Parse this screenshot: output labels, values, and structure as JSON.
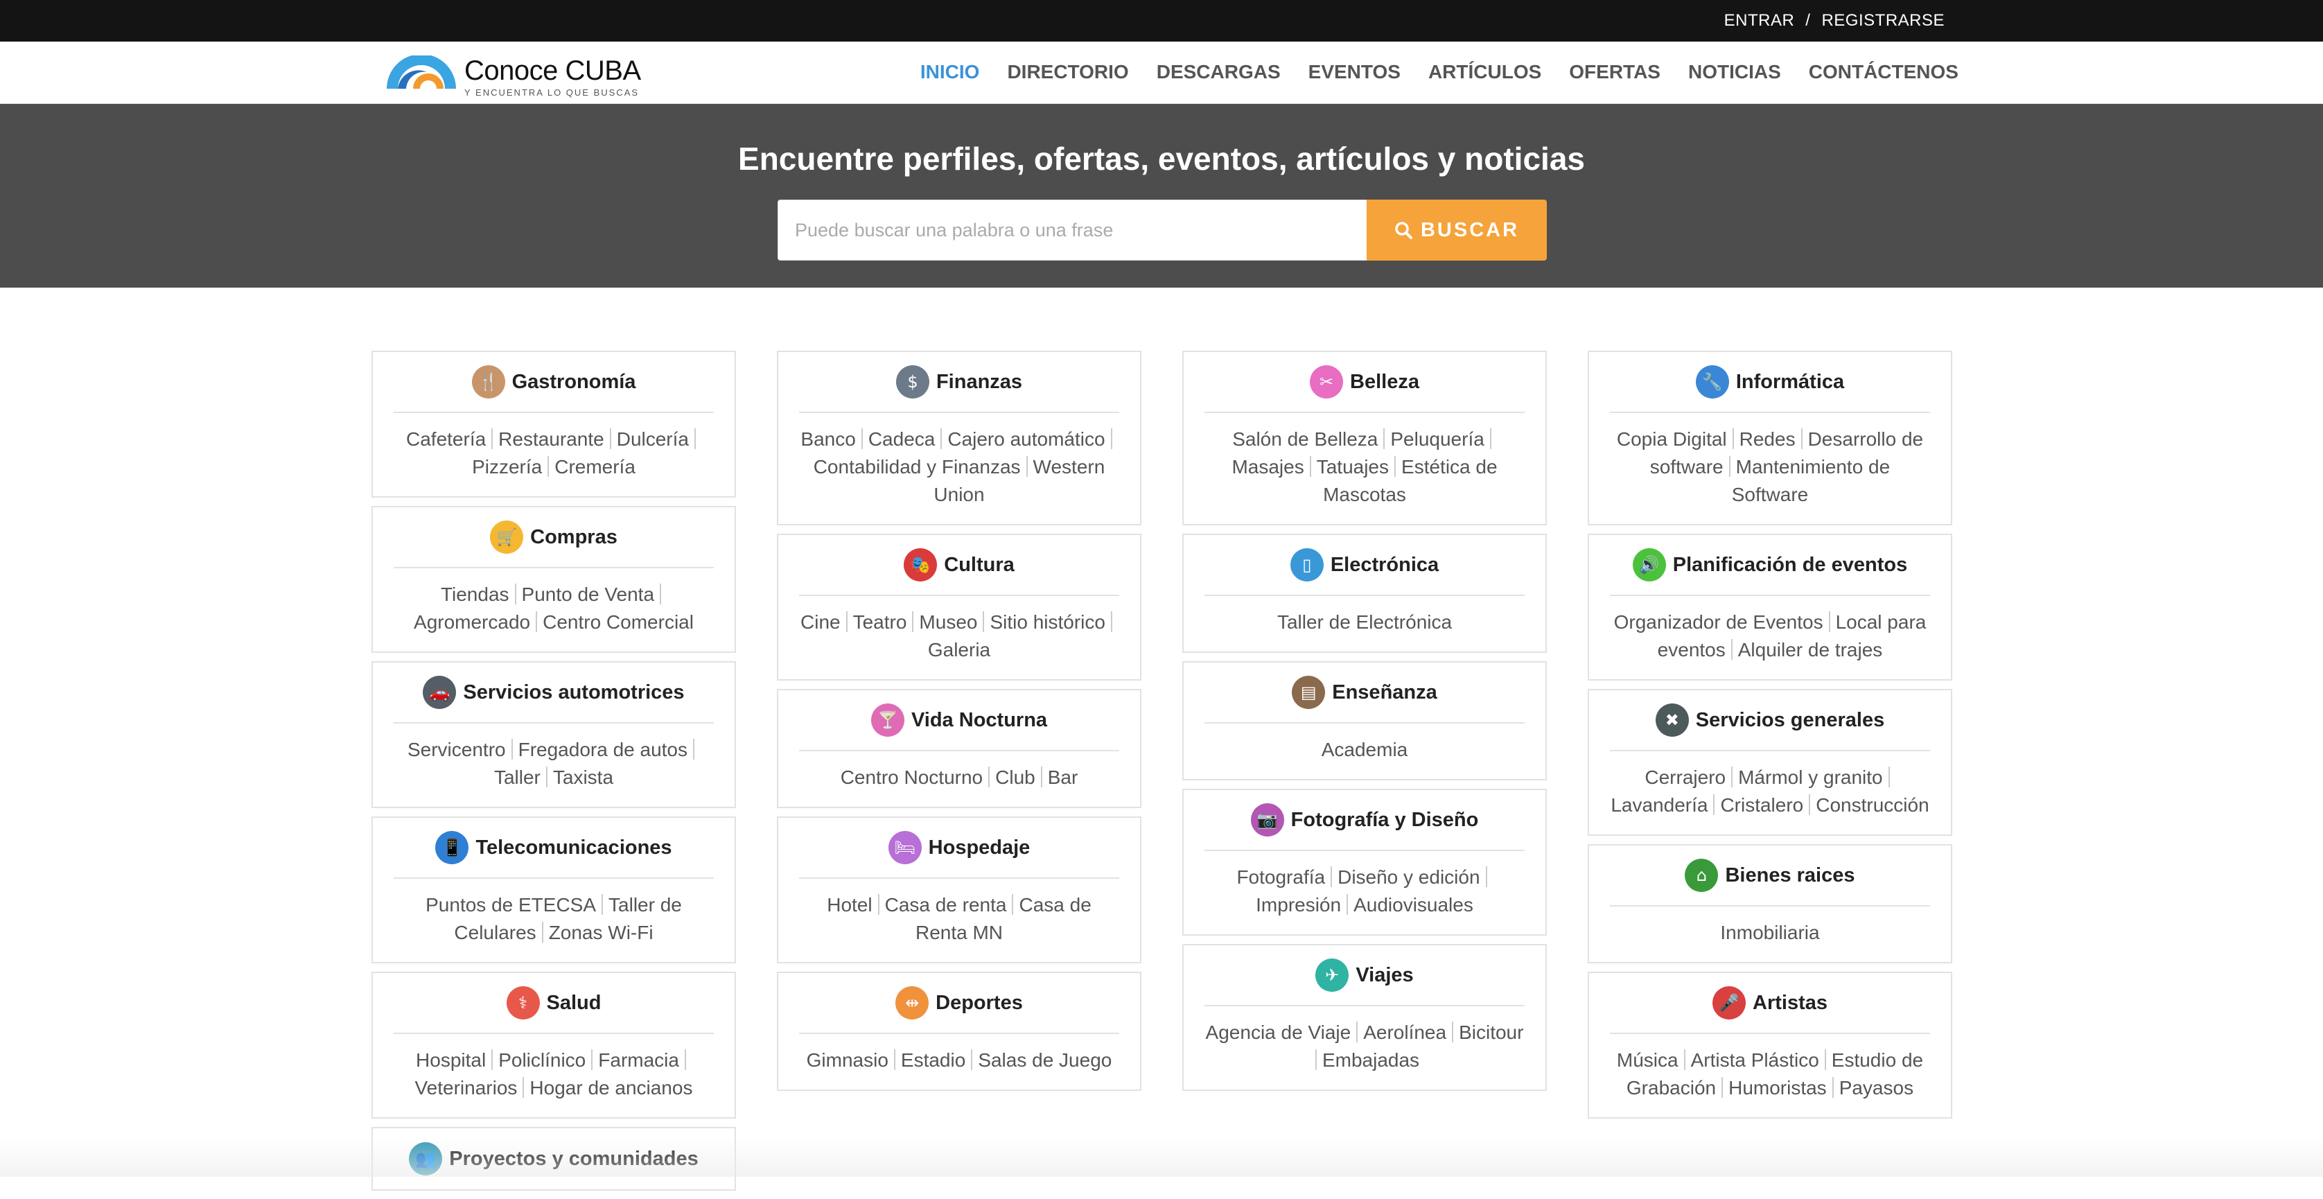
{
  "topbar": {
    "login": "ENTRAR",
    "separator": "/",
    "register": "REGISTRARSE"
  },
  "brand": {
    "name": "Conoce CUBA",
    "tagline": "Y ENCUENTRA LO QUE BUSCAS"
  },
  "nav": [
    "INICIO",
    "DIRECTORIO",
    "DESCARGAS",
    "EVENTOS",
    "ARTÍCULOS",
    "OFERTAS",
    "NOTICIAS",
    "CONTÁCTENOS"
  ],
  "hero": {
    "title": "Encuentre perfiles, ofertas, eventos, artículos y noticias",
    "search_placeholder": "Puede buscar una palabra o una frase",
    "search_value": "",
    "search_button": "BUSCAR"
  },
  "columns": [
    [
      {
        "title": "Gastronomía",
        "icon": "utensils-icon",
        "color": "#c8956a",
        "links": [
          "Cafetería",
          "Restaurante",
          "Dulcería",
          "Pizzería",
          "Cremería"
        ]
      },
      {
        "title": "Compras",
        "icon": "shopping-cart-icon",
        "color": "#f5b731",
        "links": [
          "Tiendas",
          "Punto de Venta",
          "Agromercado",
          "Centro Comercial"
        ]
      },
      {
        "title": "Servicios automotrices",
        "icon": "car-icon",
        "color": "#555e66",
        "links": [
          "Servicentro",
          "Fregadora de autos",
          "Taller",
          "Taxista"
        ]
      },
      {
        "title": "Telecomunicaciones",
        "icon": "mobile-phone-icon",
        "color": "#2f7fd4",
        "links": [
          "Puntos de ETECSA",
          "Taller de Celulares",
          "Zonas Wi-Fi"
        ]
      },
      {
        "title": "Salud",
        "icon": "stethoscope-icon",
        "color": "#e8584a",
        "links": [
          "Hospital",
          "Policlínico",
          "Farmacia",
          "Veterinarios",
          "Hogar de ancianos"
        ]
      },
      {
        "title": "Proyectos y comunidades",
        "icon": "users-icon",
        "color": "#3a9bb8",
        "links": []
      }
    ],
    [
      {
        "title": "Finanzas",
        "icon": "money-icon",
        "color": "#6c7a89",
        "links": [
          "Banco",
          "Cadeca",
          "Cajero automático",
          "Contabilidad y Finanzas",
          "Western Union"
        ]
      },
      {
        "title": "Cultura",
        "icon": "theater-masks-icon",
        "color": "#d93b3b",
        "links": [
          "Cine",
          "Teatro",
          "Museo",
          "Sitio histórico",
          "Galeria"
        ]
      },
      {
        "title": "Vida Nocturna",
        "icon": "cocktail-icon",
        "color": "#e06bb5",
        "links": [
          "Centro Nocturno",
          "Club",
          "Bar"
        ]
      },
      {
        "title": "Hospedaje",
        "icon": "bed-icon",
        "color": "#b86fd6",
        "links": [
          "Hotel",
          "Casa de renta",
          "Casa de Renta MN"
        ]
      },
      {
        "title": "Deportes",
        "icon": "dumbbell-icon",
        "color": "#f0913c",
        "links": [
          "Gimnasio",
          "Estadio",
          "Salas de Juego"
        ]
      }
    ],
    [
      {
        "title": "Belleza",
        "icon": "scissors-icon",
        "color": "#e86dc3",
        "links": [
          "Salón de Belleza",
          "Peluquería",
          "Masajes",
          "Tatuajes",
          "Estética de Mascotas"
        ]
      },
      {
        "title": "Electrónica",
        "icon": "tablet-icon",
        "color": "#3a98d8",
        "links": [
          "Taller de Electrónica"
        ]
      },
      {
        "title": "Enseñanza",
        "icon": "blackboard-icon",
        "color": "#8a6a4c",
        "links": [
          "Academia"
        ]
      },
      {
        "title": "Fotografía y Diseño",
        "icon": "camera-icon",
        "color": "#b456b4",
        "links": [
          "Fotografía",
          "Diseño y edición",
          "Impresión",
          "Audiovisuales"
        ]
      },
      {
        "title": "Viajes",
        "icon": "plane-icon",
        "color": "#2fb3a3",
        "links": [
          "Agencia de Viaje",
          "Aerolínea",
          "Bicitour",
          "Embajadas"
        ]
      }
    ],
    [
      {
        "title": "Informática",
        "icon": "wrench-icon",
        "color": "#3a87d8",
        "links": [
          "Copia Digital",
          "Redes",
          "Desarrollo de software",
          "Mantenimiento de Software"
        ]
      },
      {
        "title": "Planificación de eventos",
        "icon": "speaker-icon",
        "color": "#4cc23c",
        "links": [
          "Organizador de Eventos",
          "Local para eventos",
          "Alquiler de trajes"
        ]
      },
      {
        "title": "Servicios generales",
        "icon": "tools-icon",
        "color": "#4d5a5c",
        "links": [
          "Cerrajero",
          "Mármol y granito",
          "Lavandería",
          "Cristalero",
          "Construcción"
        ]
      },
      {
        "title": "Bienes raices",
        "icon": "house-icon",
        "color": "#3a9a3a",
        "links": [
          "Inmobiliaria"
        ]
      },
      {
        "title": "Artistas",
        "icon": "microphone-icon",
        "color": "#d94040",
        "links": [
          "Música",
          "Artista Plástico",
          "Estudio de Grabación",
          "Humoristas",
          "Payasos"
        ]
      }
    ]
  ]
}
